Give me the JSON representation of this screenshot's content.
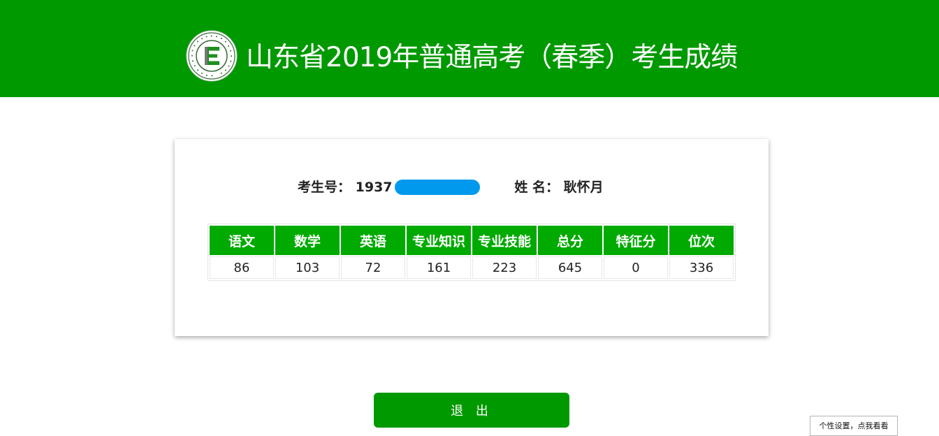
{
  "header": {
    "title": "山东省2019年普通高考（春季）考生成绩",
    "logo_text": "Shandong Education Admission & Examination · 山东省教育招生考试院"
  },
  "candidate": {
    "id_label": "考生号：",
    "id_value": "1937",
    "name_label": "姓 名：",
    "name_value": "耿怀月"
  },
  "scores": {
    "headers": [
      "语文",
      "数学",
      "英语",
      "专业知识",
      "专业技能",
      "总分",
      "特征分",
      "位次"
    ],
    "values": [
      "86",
      "103",
      "72",
      "161",
      "223",
      "645",
      "0",
      "336"
    ]
  },
  "buttons": {
    "logout": "退 出",
    "personal_settings": "个性设置，点我看看"
  },
  "colors": {
    "header_bg": "#009900",
    "table_header_bg": "#00aa00",
    "redaction": "#0099ee"
  }
}
